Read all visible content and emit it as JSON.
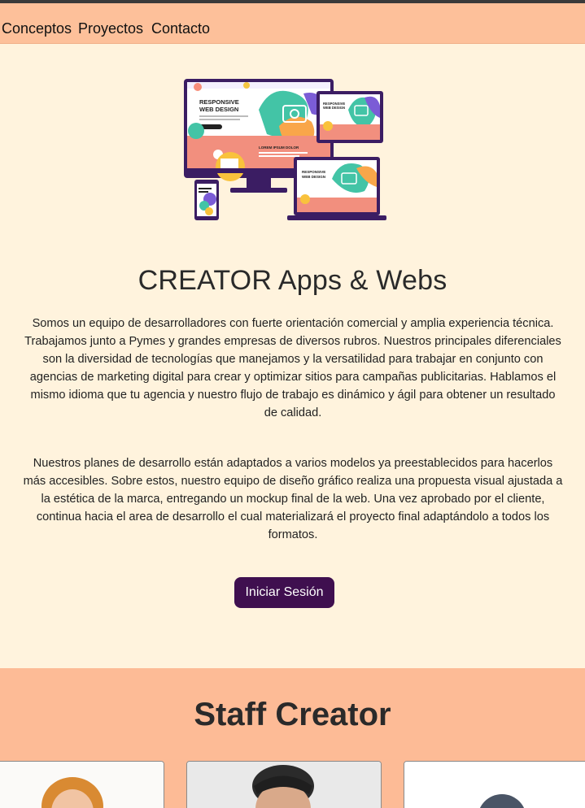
{
  "nav": {
    "items": [
      "Conceptos",
      "Proyectos",
      "Contacto"
    ]
  },
  "hero": {
    "image_texts": {
      "desktop_title_1": "RESPONSIVE",
      "desktop_title_2": "WEB DESIGN",
      "tablet_title_1": "RESPONSIVE",
      "tablet_title_2": "WEB DESIGN",
      "laptop_title_1": "RESPONSIVE",
      "laptop_title_2": "WEB DESIGN",
      "lorem": "LOREM IPSUM DOLOR"
    },
    "title": "CREATOR Apps & Webs",
    "paragraph_1": "Somos un equipo de desarrolladores con fuerte orientación comercial y amplia experiencia técnica. Trabajamos junto a Pymes y grandes empresas de diversos rubros. Nuestros principales diferenciales son la diversidad de tecnologías que manejamos y la versatilidad para trabajar en conjunto con agencias de marketing digital para crear y optimizar sitios para campañas publicitarias. Hablamos el mismo idioma que tu agencia y nuestro flujo de trabajo es dinámico y ágil para obtener un resultado de calidad.",
    "paragraph_2": "Nuestros planes de desarrollo están adaptados a varios modelos ya preestablecidos para hacerlos más accesibles. Sobre estos, nuestro equipo de diseño gráfico realiza una propuesta visual ajustada a la estética de la marca, entregando un mockup final de la web. Una vez aprobado por el cliente, continua hacia el area de desarrollo el cual materializará el proyecto final adaptándolo a todos los formatos.",
    "login_label": "Iniciar Sesión"
  },
  "staff": {
    "title": "Staff Creator"
  },
  "colors": {
    "nav_bg": "#fdc09a",
    "page_bg": "#fff3dd",
    "button_bg": "#3f0f4f",
    "staff_bg": "#fdbb96"
  }
}
